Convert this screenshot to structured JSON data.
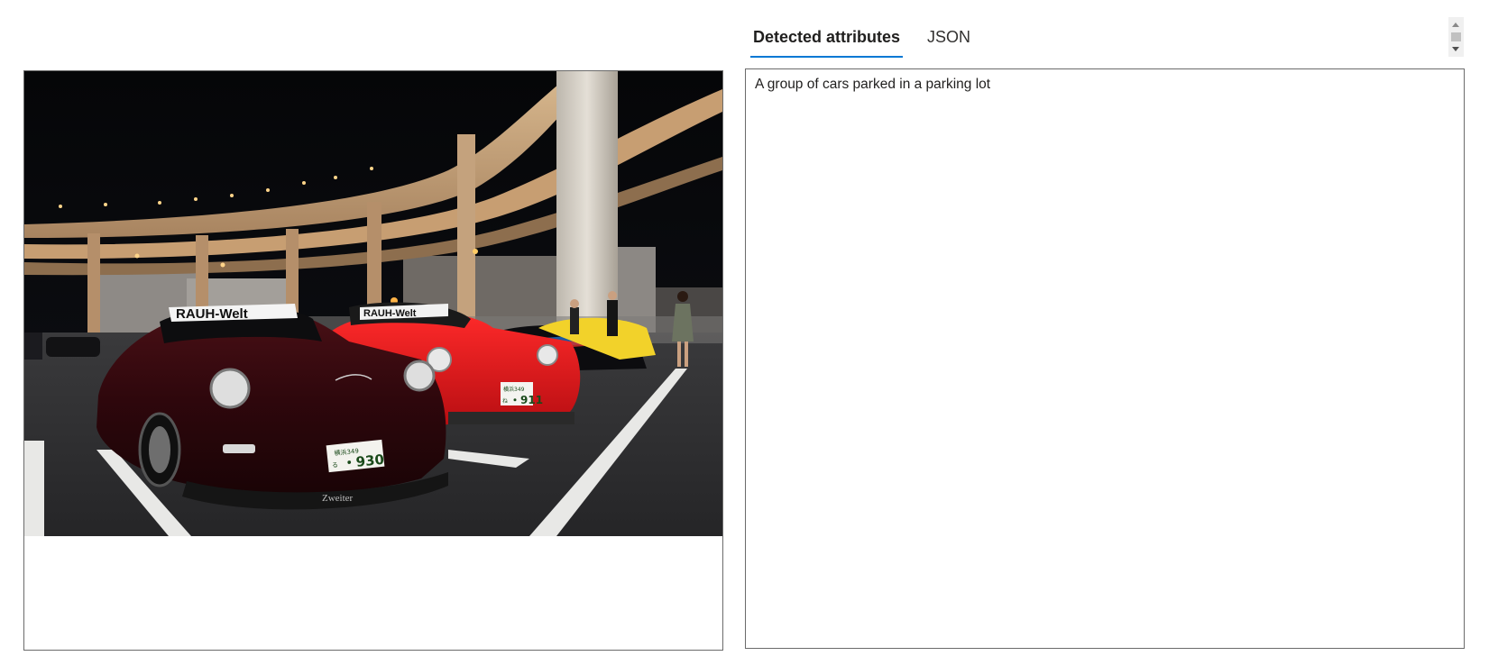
{
  "tabs": [
    {
      "label": "Detected attributes",
      "active": true
    },
    {
      "label": "JSON",
      "active": false
    }
  ],
  "result": {
    "caption": "A group of cars parked in a parking lot"
  },
  "image": {
    "plate_main": "・930",
    "plate_prefix": "横浜349",
    "plate_hiragana": "る",
    "plate_red": "・911",
    "plate_red_prefix": "横浜349",
    "plate_red_hiragana": "ね",
    "windshield_banner": "RAUH-Welt",
    "lip_text": "Zweiter"
  },
  "colors": {
    "accent": "#0078d4",
    "border": "#6b6b6b"
  }
}
